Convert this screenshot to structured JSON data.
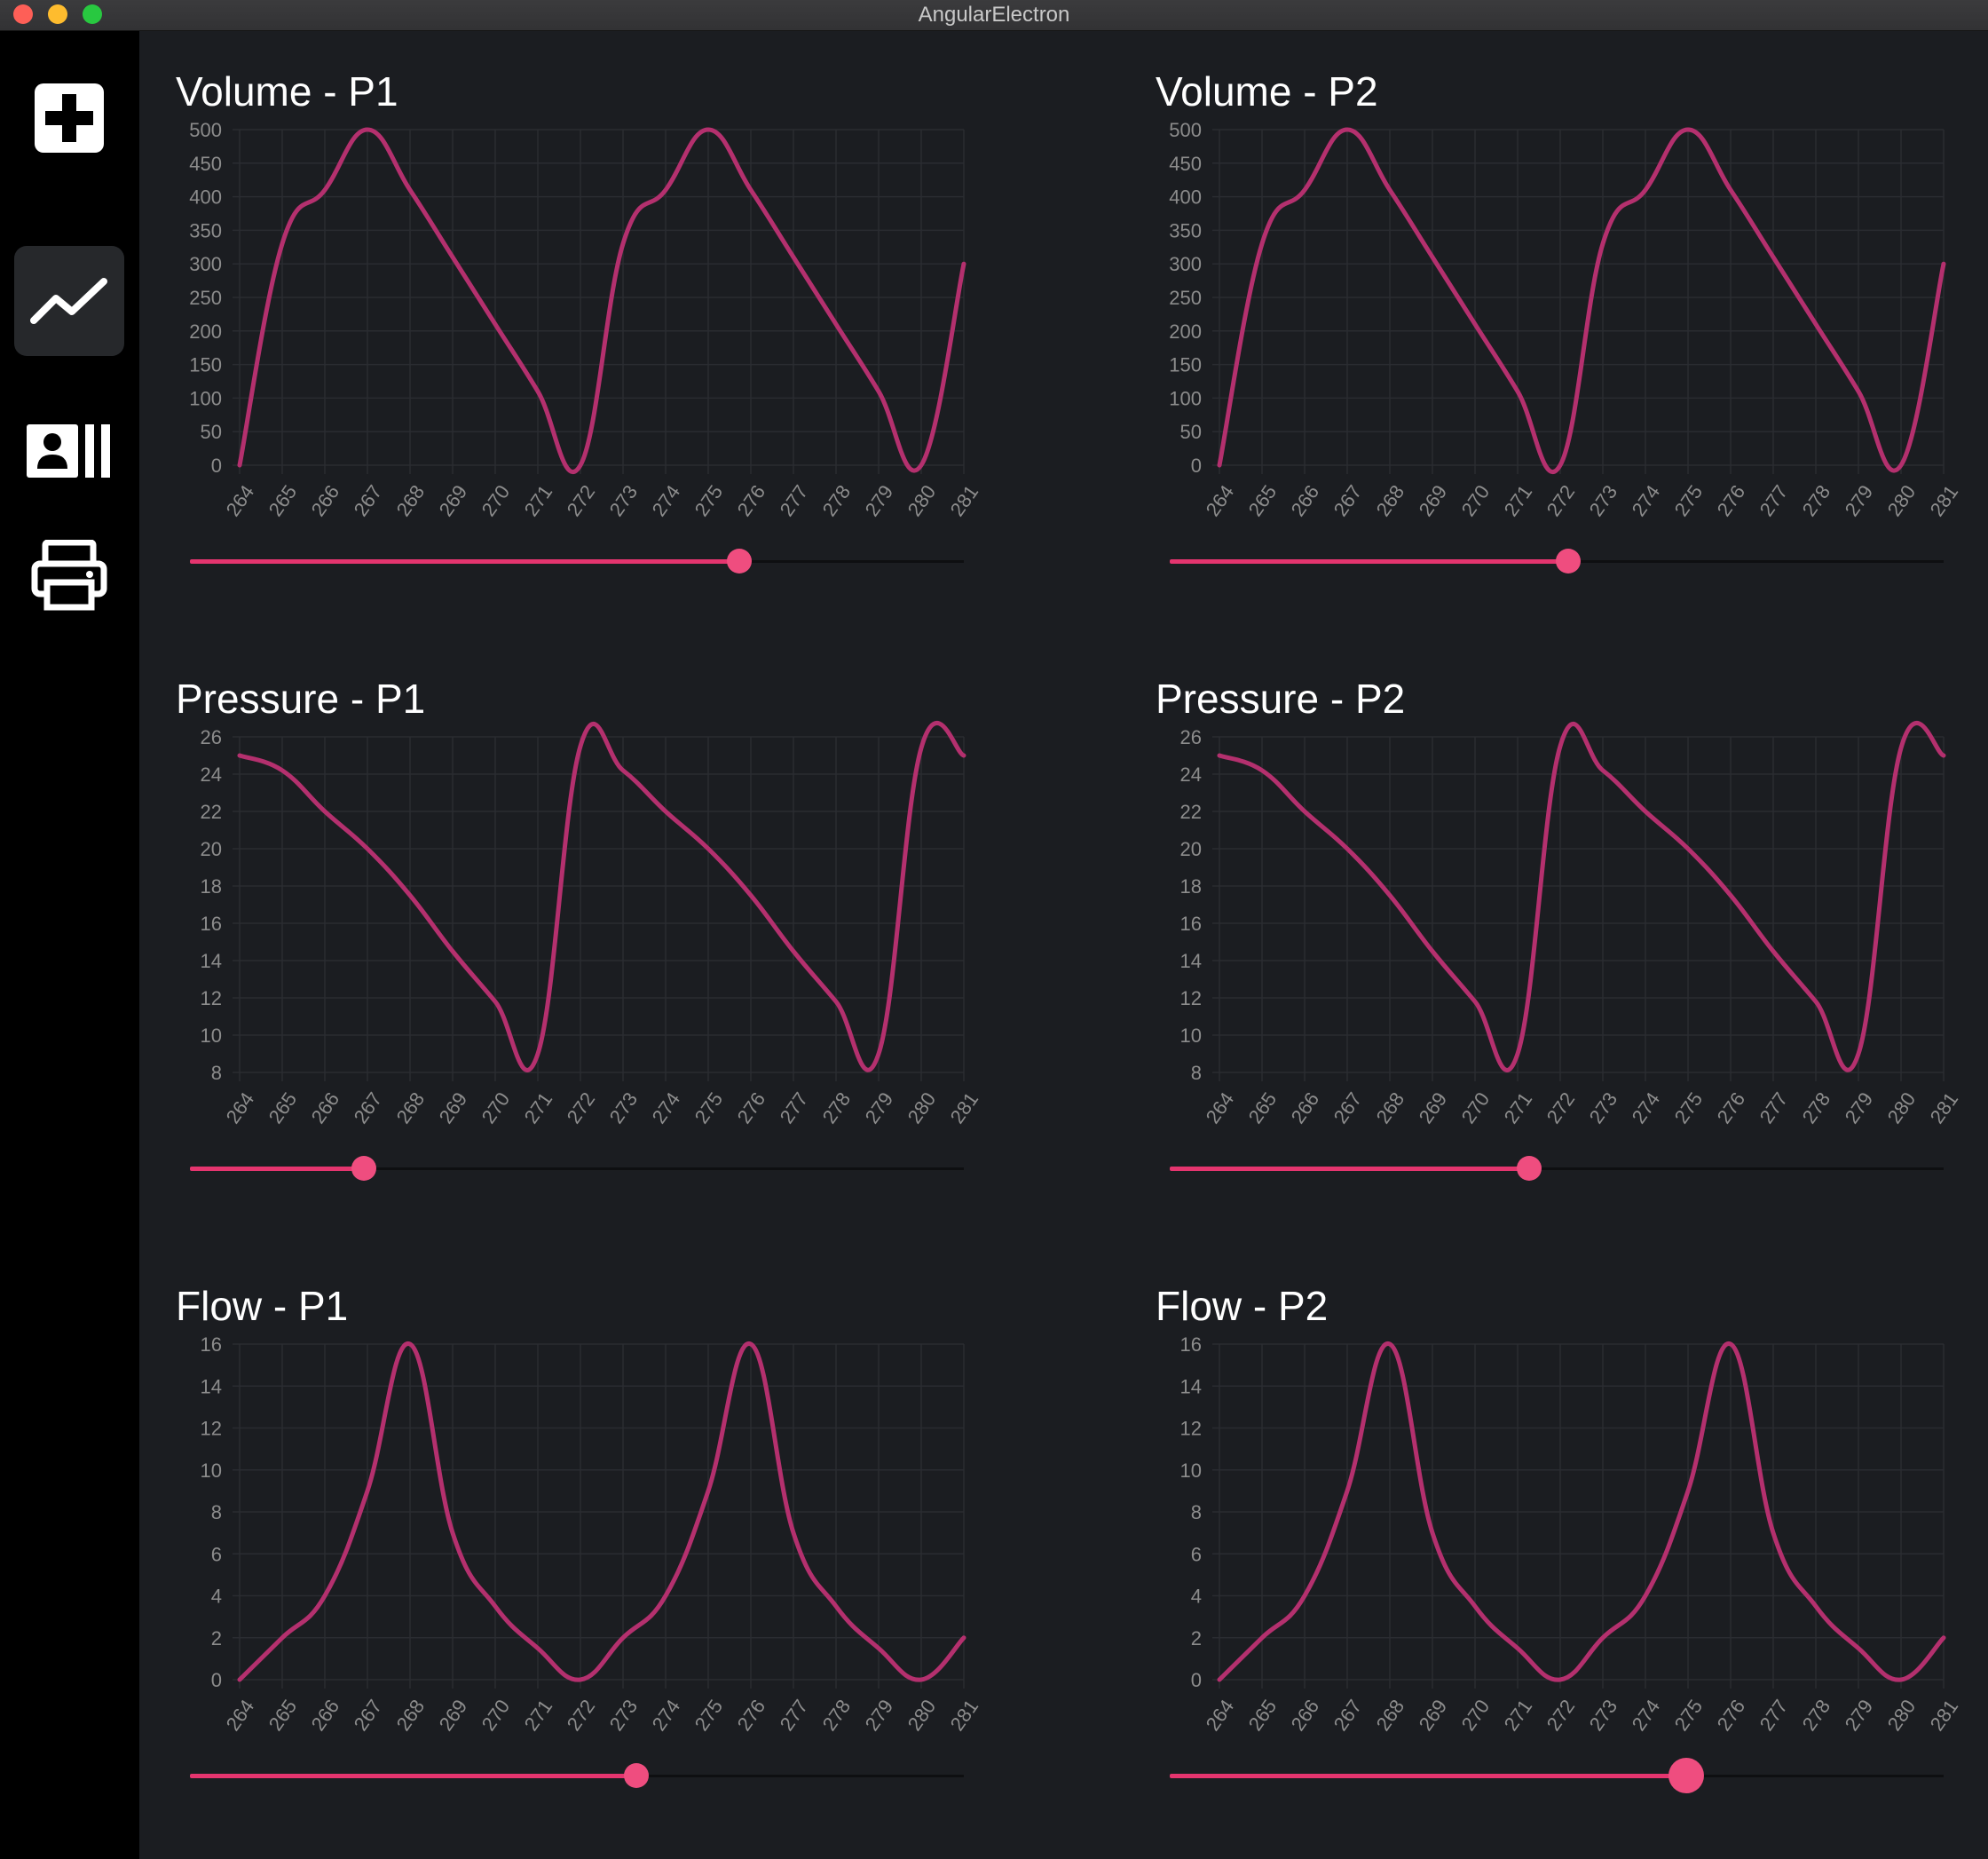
{
  "window": {
    "title": "AngularElectron"
  },
  "sidebar": {
    "items": [
      {
        "id": "medical",
        "icon": "medical-cross-icon"
      },
      {
        "id": "charts",
        "icon": "line-chart-icon",
        "active": true
      },
      {
        "id": "patients",
        "icon": "patient-card-icon"
      },
      {
        "id": "print",
        "icon": "printer-icon"
      }
    ]
  },
  "colors": {
    "line": "#b4306e",
    "slider": "#e5356f",
    "background": "#1b1d21"
  },
  "chart_data": [
    {
      "id": "volume-p1",
      "type": "line",
      "title": "Volume - P1",
      "x": [
        264,
        265,
        266,
        267,
        268,
        269,
        270,
        271,
        272,
        273,
        274,
        275,
        276,
        277,
        278,
        279,
        280,
        281
      ],
      "y": [
        0,
        330,
        410,
        500,
        410,
        310,
        210,
        110,
        0,
        330,
        410,
        500,
        410,
        310,
        210,
        110,
        0,
        300
      ],
      "yticks": [
        "0",
        "50",
        "100",
        "150",
        "200",
        "250",
        "300",
        "350",
        "400",
        "450",
        "500"
      ],
      "ylim": [
        0,
        500
      ],
      "grid": true,
      "slider_value": 0.71
    },
    {
      "id": "volume-p2",
      "type": "line",
      "title": "Volume - P2",
      "x": [
        264,
        265,
        266,
        267,
        268,
        269,
        270,
        271,
        272,
        273,
        274,
        275,
        276,
        277,
        278,
        279,
        280,
        281
      ],
      "y": [
        0,
        330,
        410,
        500,
        410,
        310,
        210,
        110,
        0,
        330,
        410,
        500,
        410,
        310,
        210,
        110,
        0,
        300
      ],
      "yticks": [
        "0",
        "50",
        "100",
        "150",
        "200",
        "250",
        "300",
        "350",
        "400",
        "450",
        "500"
      ],
      "ylim": [
        0,
        500
      ],
      "grid": true,
      "slider_value": 0.515
    },
    {
      "id": "pressure-p1",
      "type": "line",
      "title": "Pressure - P1",
      "x": [
        264,
        265,
        266,
        267,
        268,
        269,
        270,
        271,
        272,
        273,
        274,
        275,
        276,
        277,
        278,
        279,
        280,
        281
      ],
      "y": [
        25,
        24.2,
        22,
        20,
        17.5,
        14.5,
        11.8,
        9,
        25.5,
        24.2,
        22,
        20,
        17.5,
        14.5,
        11.8,
        9,
        25.4,
        25
      ],
      "yticks": [
        "8",
        "10",
        "12",
        "14",
        "16",
        "18",
        "20",
        "22",
        "24",
        "26"
      ],
      "ylim": [
        8,
        26
      ],
      "grid": true,
      "slider_value": 0.225
    },
    {
      "id": "pressure-p2",
      "type": "line",
      "title": "Pressure - P2",
      "x": [
        264,
        265,
        266,
        267,
        268,
        269,
        270,
        271,
        272,
        273,
        274,
        275,
        276,
        277,
        278,
        279,
        280,
        281
      ],
      "y": [
        25,
        24.2,
        22,
        20,
        17.5,
        14.5,
        11.8,
        9,
        25.5,
        24.2,
        22,
        20,
        17.5,
        14.5,
        11.8,
        9,
        25.4,
        25
      ],
      "yticks": [
        "8",
        "10",
        "12",
        "14",
        "16",
        "18",
        "20",
        "22",
        "24",
        "26"
      ],
      "ylim": [
        8,
        26
      ],
      "grid": true,
      "slider_value": 0.465
    },
    {
      "id": "flow-p1",
      "type": "line",
      "title": "Flow - P1",
      "x": [
        264,
        265,
        266,
        267,
        268,
        269,
        270,
        271,
        272,
        273,
        274,
        275,
        276,
        277,
        278,
        279,
        280,
        281
      ],
      "y": [
        0,
        2,
        4,
        9,
        16,
        7,
        3.5,
        1.5,
        0,
        2,
        4,
        9,
        16,
        7,
        3.5,
        1.5,
        0,
        2
      ],
      "yticks": [
        "0",
        "2",
        "4",
        "6",
        "8",
        "10",
        "12",
        "14",
        "16"
      ],
      "ylim": [
        0,
        16
      ],
      "grid": true,
      "slider_value": 0.577
    },
    {
      "id": "flow-p2",
      "type": "line",
      "title": "Flow - P2",
      "x": [
        264,
        265,
        266,
        267,
        268,
        269,
        270,
        271,
        272,
        273,
        274,
        275,
        276,
        277,
        278,
        279,
        280,
        281
      ],
      "y": [
        0,
        2,
        4,
        9,
        16,
        7,
        3.5,
        1.5,
        0,
        2,
        4,
        9,
        16,
        7,
        3.5,
        1.5,
        0,
        2
      ],
      "yticks": [
        "0",
        "2",
        "4",
        "6",
        "8",
        "10",
        "12",
        "14",
        "16"
      ],
      "ylim": [
        0,
        16
      ],
      "grid": true,
      "slider_value": 0.667
    }
  ]
}
